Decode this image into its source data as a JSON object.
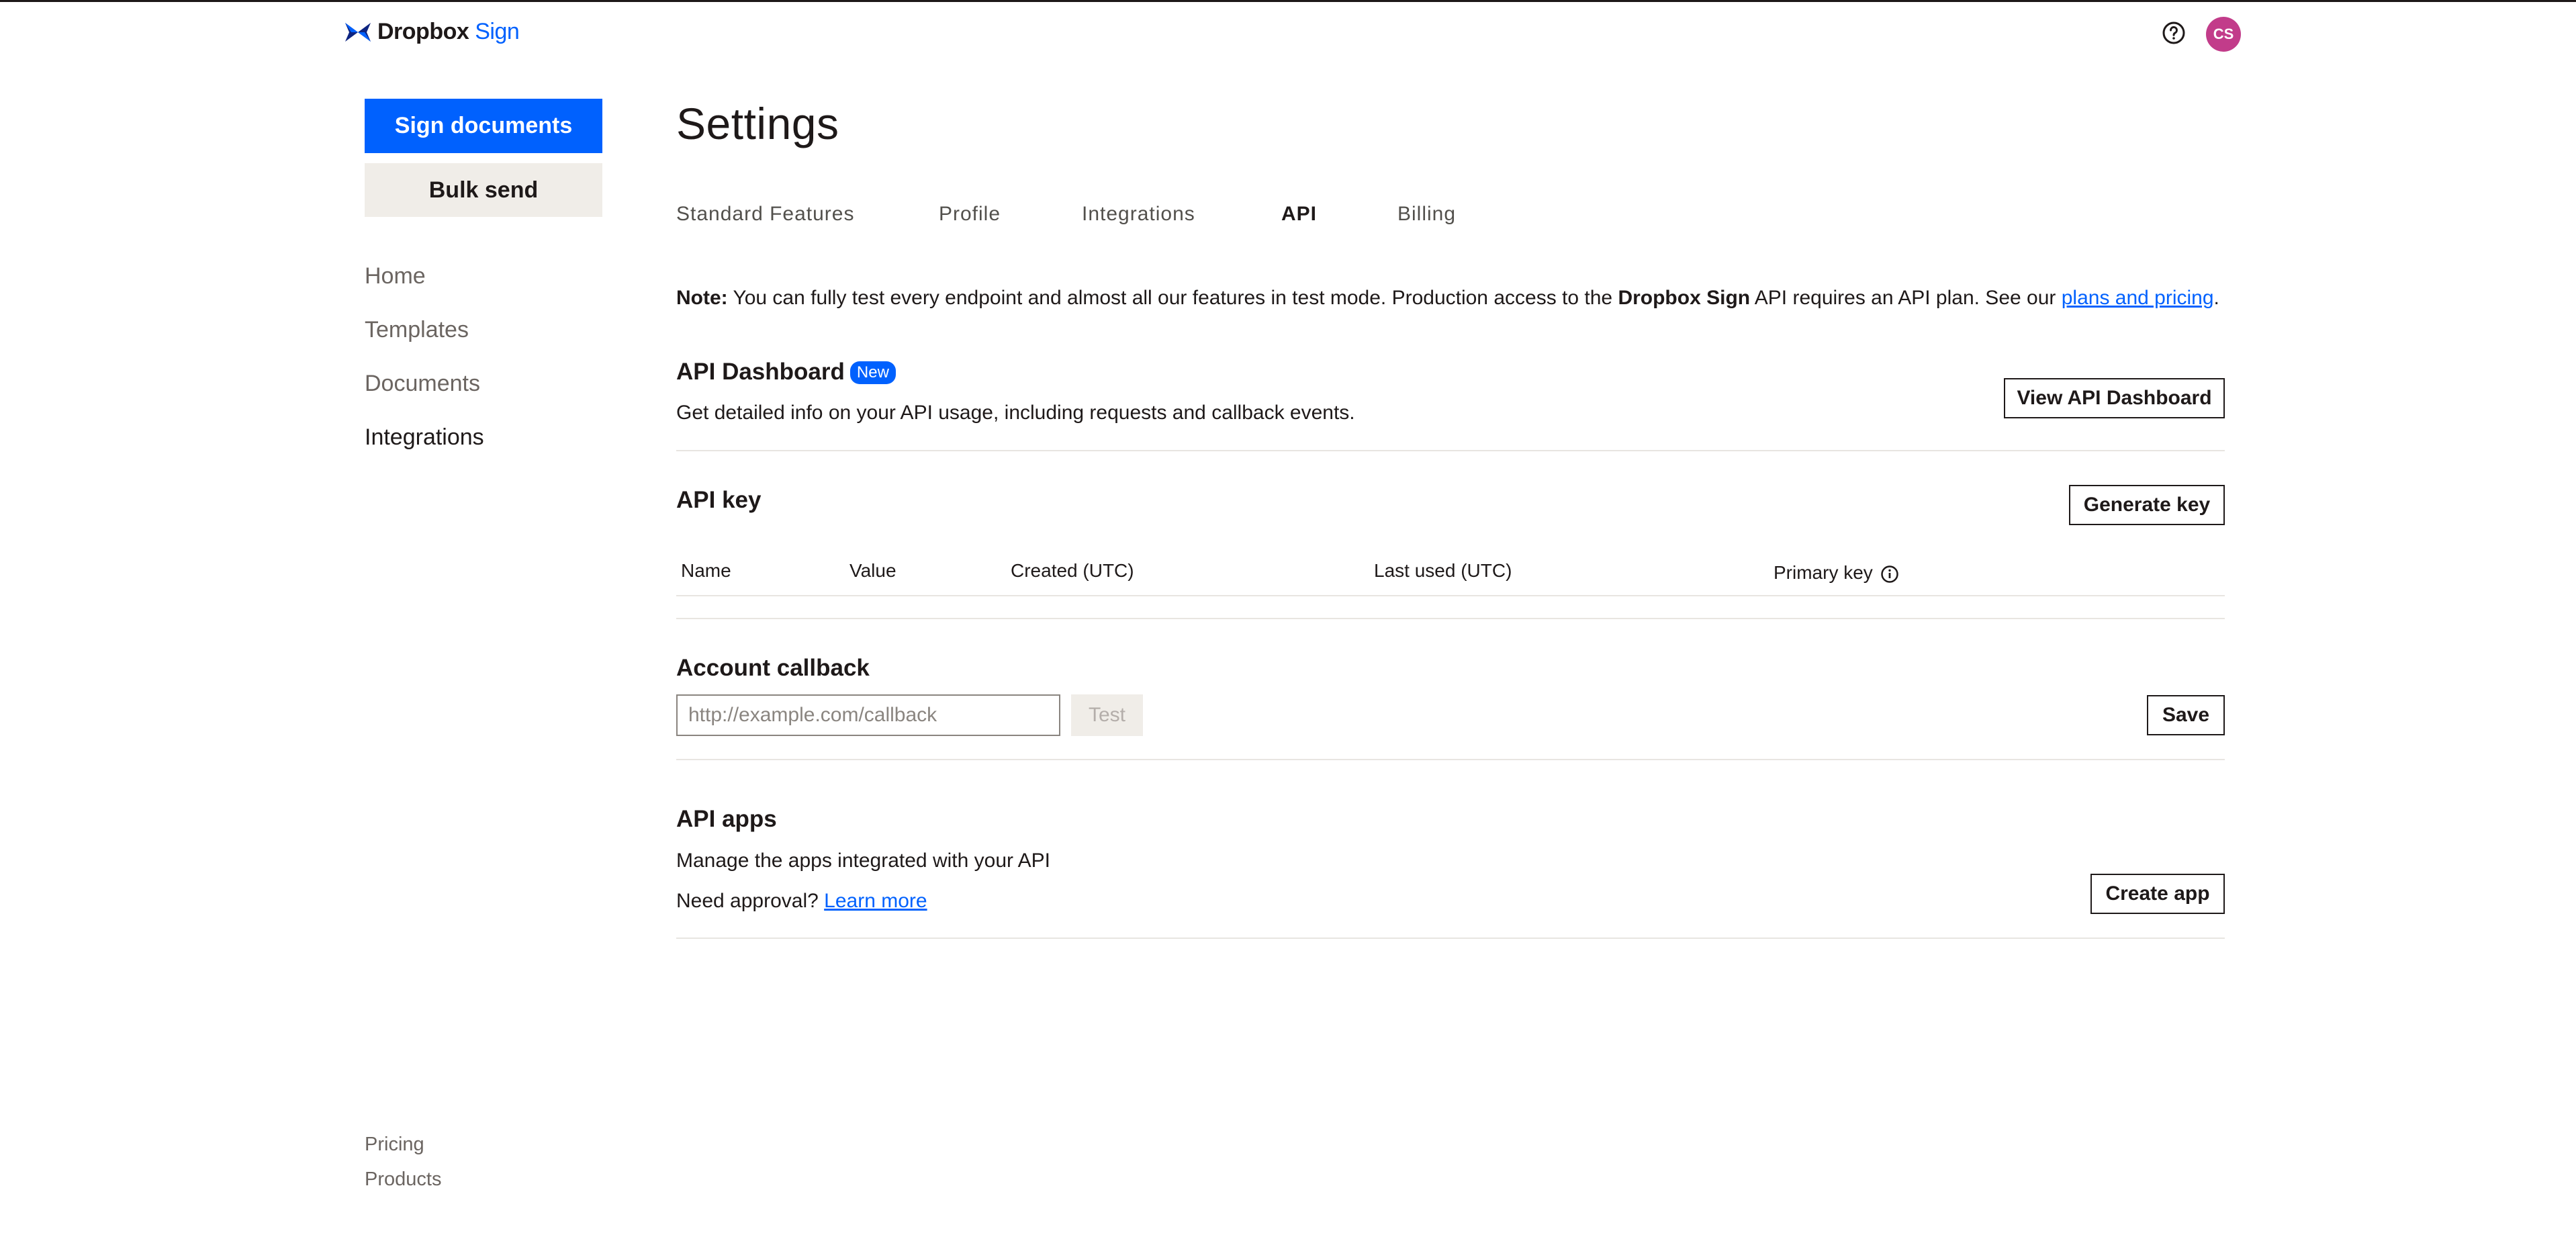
{
  "header": {
    "brand_primary": "Dropbox",
    "brand_secondary": "Sign",
    "avatar_initials": "CS",
    "brand_color": "#0061fe",
    "avatar_color": "#c23c8a"
  },
  "sidebar": {
    "sign_documents": "Sign documents",
    "bulk_send": "Bulk send",
    "items": [
      {
        "label": "Home"
      },
      {
        "label": "Templates"
      },
      {
        "label": "Documents"
      },
      {
        "label": "Integrations",
        "active": true
      }
    ],
    "footer": [
      {
        "label": "Pricing"
      },
      {
        "label": "Products"
      }
    ]
  },
  "page": {
    "title": "Settings",
    "tabs": [
      {
        "label": "Standard Features"
      },
      {
        "label": "Profile"
      },
      {
        "label": "Integrations"
      },
      {
        "label": "API",
        "active": true
      },
      {
        "label": "Billing"
      }
    ]
  },
  "note": {
    "label": "Note:",
    "text1": " You can fully test every endpoint and almost all our features in test mode. Production access to the ",
    "brand": "Dropbox Sign",
    "text2": " API requires an API plan. See our ",
    "link": "plans and pricing",
    "end": "."
  },
  "api_dashboard": {
    "title": "API Dashboard",
    "badge": "New",
    "description": "Get detailed info on your API usage, including requests and callback events.",
    "button": "View API Dashboard"
  },
  "api_key": {
    "title": "API key",
    "button": "Generate key",
    "columns": [
      "Name",
      "Value",
      "Created (UTC)",
      "Last used (UTC)",
      "Primary key"
    ]
  },
  "account_callback": {
    "title": "Account callback",
    "placeholder": "http://example.com/callback",
    "value": "",
    "test_button": "Test",
    "save_button": "Save"
  },
  "api_apps": {
    "title": "API apps",
    "description": "Manage the apps integrated with your API",
    "approval_text": "Need approval?",
    "learn_more": "Learn more",
    "button": "Create app"
  }
}
